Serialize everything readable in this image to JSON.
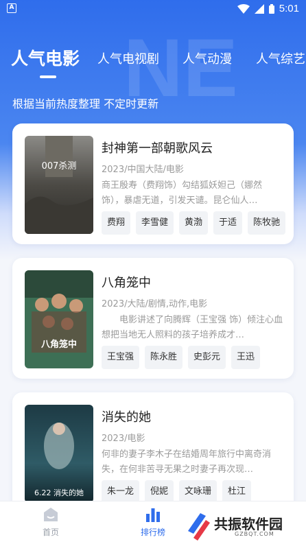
{
  "status_bar": {
    "app_icon_letter": "A",
    "time": "5:01"
  },
  "tabs": [
    {
      "label": "人气电影",
      "active": true
    },
    {
      "label": "人气电视剧",
      "active": false
    },
    {
      "label": "人气动漫",
      "active": false
    },
    {
      "label": "人气综艺",
      "active": false
    }
  ],
  "subtitle": "根据当前热度整理 不定时更新",
  "movies": [
    {
      "title": "封神第一部朝歌风云",
      "meta": "2023/中国大陆/电影",
      "desc": "商王殷寿（费翔饰）勾结狐妖妲己（娜然饰），暴虐无道，引发天谴。昆仑仙人…",
      "cast": [
        "费翔",
        "李雪健",
        "黄渤",
        "于适",
        "陈牧驰"
      ],
      "poster_text": "007杀测"
    },
    {
      "title": "八角笼中",
      "meta": "2023/大陆/剧情,动作,电影",
      "desc": "　　电影讲述了向腾辉（王宝强 饰）倾注心血想把当地无人照料的孩子培养成才…",
      "cast": [
        "王宝强",
        "陈永胜",
        "史彭元",
        "王迅"
      ],
      "poster_text": "八角笼中"
    },
    {
      "title": "消失的她",
      "meta": "2023/电影",
      "desc": "何非的妻子李木子在结婚周年旅行中离奇消失，在何非苦寻无果之时妻子再次现…",
      "cast": [
        "朱一龙",
        "倪妮",
        "文咏珊",
        "杜江"
      ],
      "poster_text": "6.22 消失的她"
    }
  ],
  "bottom_nav": [
    {
      "label": "首页",
      "icon": "home-icon",
      "active": false
    },
    {
      "label": "排行榜",
      "icon": "ranking-icon",
      "active": true
    }
  ],
  "watermark": {
    "title": "共振软件园",
    "url": "GZBQT.COM"
  },
  "colors": {
    "accent": "#2f6dec",
    "chip_bg": "#f1f3f6"
  }
}
